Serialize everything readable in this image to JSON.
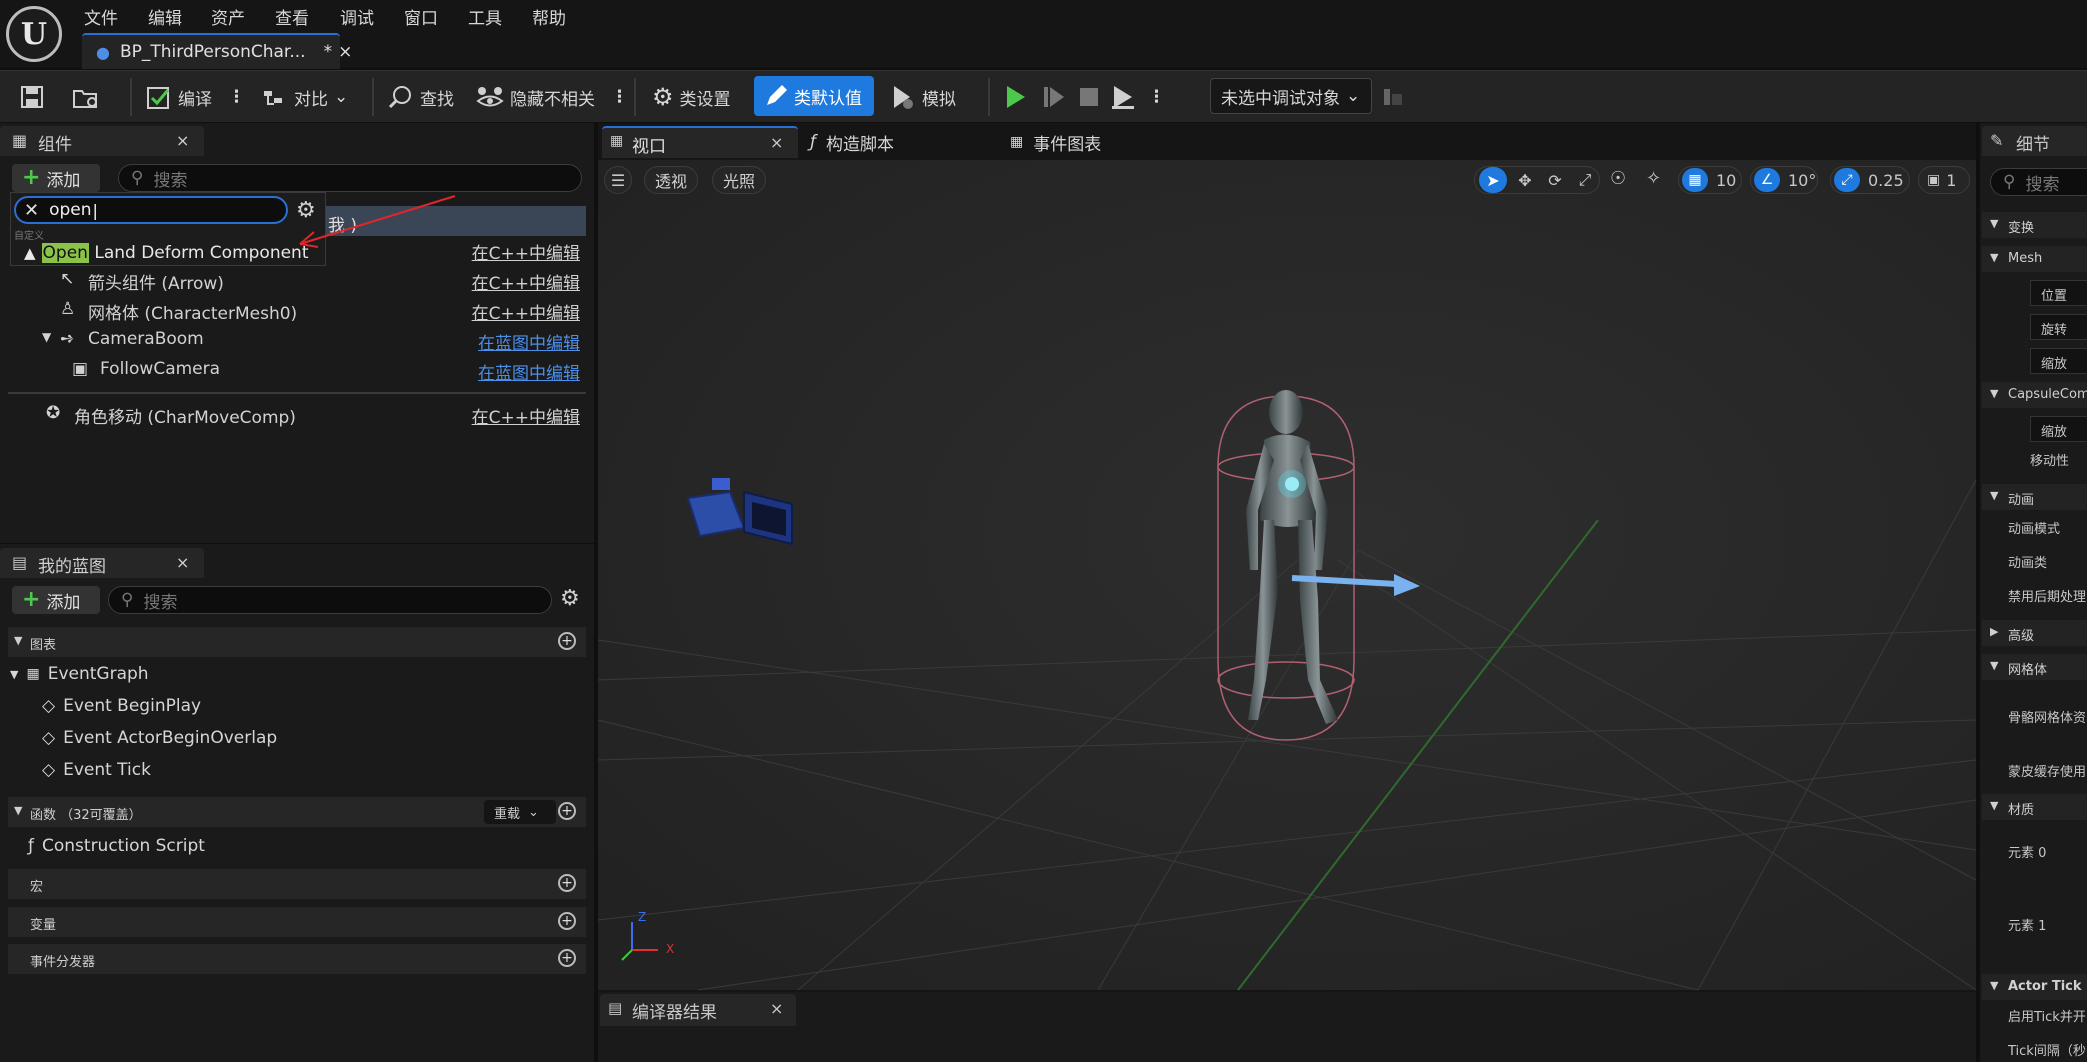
{
  "menubar": {
    "items": [
      "文件",
      "编辑",
      "资产",
      "查看",
      "调试",
      "窗口",
      "工具",
      "帮助"
    ]
  },
  "doc_tab": {
    "title": "BP_ThirdPersonChar...",
    "modified": "*",
    "close": "×"
  },
  "toolbar": {
    "compile": "编译",
    "diff": "对比",
    "find": "查找",
    "hide_unrelated": "隐藏不相关",
    "class_settings": "类设置",
    "class_defaults": "类默认值",
    "simulate": "模拟",
    "debug_object": "未选中调试对象"
  },
  "components": {
    "title": "组件",
    "close": "×",
    "add": "添加",
    "search_placeholder": "搜索",
    "popup": {
      "query": "open",
      "section": "自定义",
      "result_highlight": "Open",
      "result_rest": " Land Deform Component",
      "self_suffix": "我 )"
    },
    "rows": [
      {
        "label": "",
        "action": "在C++中编辑"
      },
      {
        "label": "箭头组件 (Arrow)",
        "action": "在C++中编辑"
      },
      {
        "label": "网格体 (CharacterMesh0)",
        "action": "在C++中编辑"
      },
      {
        "label": "CameraBoom",
        "action": "在蓝图中编辑"
      },
      {
        "label": "FollowCamera",
        "action": "在蓝图中编辑"
      },
      {
        "label": "角色移动 (CharMoveComp)",
        "action": "在C++中编辑"
      }
    ]
  },
  "my_blueprint": {
    "title": "我的蓝图",
    "close": "×",
    "add": "添加",
    "search_placeholder": "搜索",
    "graphs_header": "图表",
    "event_graph": "EventGraph",
    "events": [
      "Event BeginPlay",
      "Event ActorBeginOverlap",
      "Event Tick"
    ],
    "functions_header": "函数 （32可覆盖）",
    "override": "重载",
    "construction": "Construction Script",
    "macros": "宏",
    "variables": "变量",
    "dispatchers": "事件分发器"
  },
  "viewport": {
    "tabs": [
      "视口",
      "构造脚本",
      "事件图表"
    ],
    "close": "×",
    "perspective": "透视",
    "lit": "光照",
    "grid_snap": "10",
    "rot_snap": "10°",
    "scale_snap": "0.25",
    "camera_speed": "1",
    "axis_z": "Z",
    "axis_x": "X"
  },
  "compiler": {
    "title": "编译器结果",
    "close": "×"
  },
  "details": {
    "title": "细节",
    "search_placeholder": "搜索",
    "items": [
      {
        "text": "变换",
        "kind": "header"
      },
      {
        "text": "Mesh",
        "kind": "header"
      },
      {
        "text": "位置",
        "kind": "box"
      },
      {
        "text": "旋转",
        "kind": "box"
      },
      {
        "text": "缩放",
        "kind": "box"
      },
      {
        "text": "CapsuleComp",
        "kind": "header"
      },
      {
        "text": "缩放",
        "kind": "box"
      },
      {
        "text": "移动性",
        "kind": "label"
      },
      {
        "text": "动画",
        "kind": "header"
      },
      {
        "text": "动画模式",
        "kind": "label"
      },
      {
        "text": "动画类",
        "kind": "label"
      },
      {
        "text": "禁用后期处理",
        "kind": "label"
      },
      {
        "text": "高级",
        "kind": "collapsed"
      },
      {
        "text": "网格体",
        "kind": "header"
      },
      {
        "text": "骨骼网格体资",
        "kind": "label"
      },
      {
        "text": "蒙皮缓存使用",
        "kind": "label"
      },
      {
        "text": "材质",
        "kind": "header"
      },
      {
        "text": "元素 0",
        "kind": "label"
      },
      {
        "text": "元素 1",
        "kind": "label"
      },
      {
        "text": "Actor Tick",
        "kind": "header"
      },
      {
        "text": "启用Tick并开",
        "kind": "label"
      },
      {
        "text": "Tick间隔（秒",
        "kind": "label"
      }
    ]
  },
  "colors": {
    "accent": "#2a6fd6",
    "link": "#4d8fe8",
    "green": "#4cc84c",
    "highlight": "#8bc34a",
    "arrow": "#e0262a"
  }
}
